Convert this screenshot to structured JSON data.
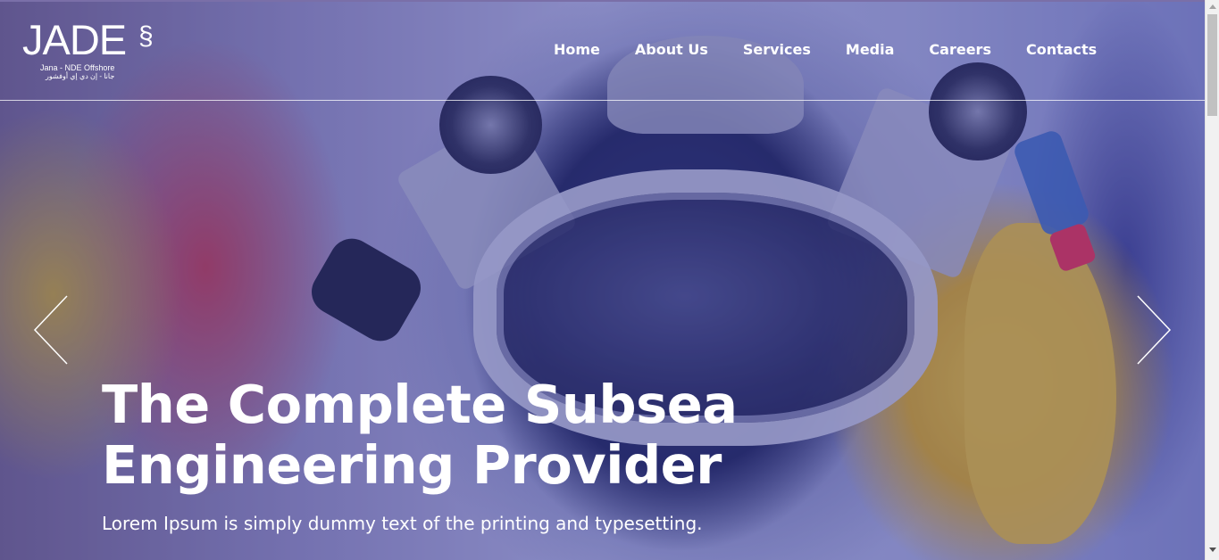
{
  "logo": {
    "word": "JADE",
    "swirl": "§",
    "subtitle": "Jana - NDE Offshore",
    "arabic": "جانا - إن دي إي أوفشور"
  },
  "nav": {
    "items": [
      {
        "label": "Home"
      },
      {
        "label": "About Us"
      },
      {
        "label": "Services"
      },
      {
        "label": "Media"
      },
      {
        "label": "Careers"
      },
      {
        "label": "Contacts"
      }
    ]
  },
  "hero": {
    "headline_line1": "The Complete Subsea",
    "headline_line2": "Engineering Provider",
    "subline": "Lorem Ipsum is simply dummy text of the printing and typesetting."
  },
  "icons": {
    "prev": "chevron-left-icon",
    "next": "chevron-right-icon"
  },
  "colors": {
    "overlay": "#3c3ea0",
    "text": "#ffffff",
    "helmet_yellow": "#d6b03a"
  }
}
